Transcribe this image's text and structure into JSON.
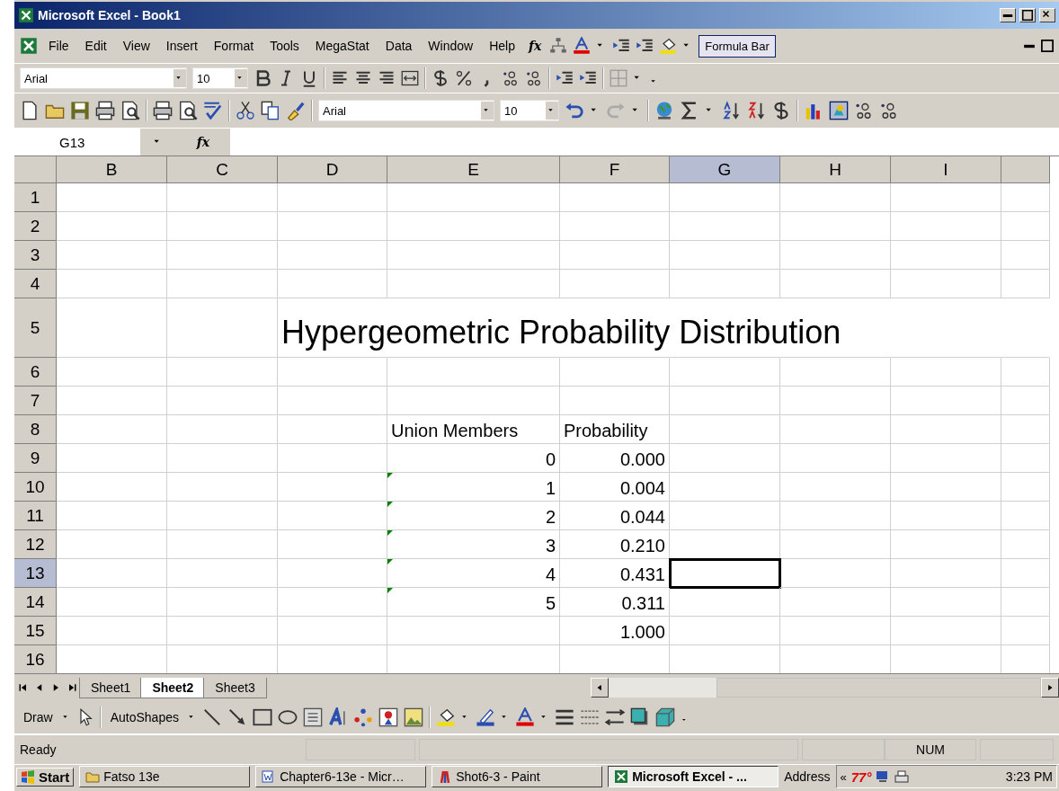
{
  "window": {
    "title": "Microsoft Excel - Book1"
  },
  "insert_function_label": [
    "fx",
    "fx"
  ],
  "menu_bar": {
    "items": [
      "File",
      "Edit",
      "View",
      "Insert",
      "Format",
      "Tools",
      "MegaStat",
      "Data",
      "Window",
      "Help"
    ],
    "formula_bar_button": "Formula Bar"
  },
  "formatting_toolbar": {
    "font": "Arial",
    "size": "10"
  },
  "standard_toolbar": {
    "font": "Arial",
    "size": "10"
  },
  "name_box": "G13",
  "columns": [
    {
      "label": "B",
      "selected": false
    },
    {
      "label": "C",
      "selected": false
    },
    {
      "label": "D",
      "selected": false
    },
    {
      "label": "E",
      "selected": false
    },
    {
      "label": "F",
      "selected": false
    },
    {
      "label": "G",
      "selected": true
    },
    {
      "label": "H",
      "selected": false
    },
    {
      "label": "I",
      "selected": false
    }
  ],
  "rows": [
    {
      "number": "1",
      "selected": false,
      "cells": {}
    },
    {
      "number": "2",
      "selected": false,
      "cells": {}
    },
    {
      "number": "3",
      "selected": false,
      "cells": {}
    },
    {
      "number": "4",
      "selected": false,
      "cells": {}
    },
    {
      "number": "5",
      "selected": false,
      "cells": {
        "D": {
          "kind": "title",
          "text": "Hypergeometric Probability Distribution"
        }
      }
    },
    {
      "number": "6",
      "selected": false,
      "cells": {}
    },
    {
      "number": "7",
      "selected": false,
      "cells": {}
    },
    {
      "number": "8",
      "selected": false,
      "cells": {
        "E": {
          "kind": "text",
          "text": "Union Members"
        },
        "F": {
          "kind": "text",
          "text": "Probability"
        }
      }
    },
    {
      "number": "9",
      "selected": false,
      "cells": {
        "E": {
          "kind": "number",
          "text": "0",
          "flag": false
        },
        "F": {
          "kind": "number",
          "text": "0.000"
        }
      }
    },
    {
      "number": "10",
      "selected": false,
      "cells": {
        "E": {
          "kind": "number",
          "text": "1",
          "flag": true
        },
        "F": {
          "kind": "number",
          "text": "0.004"
        }
      }
    },
    {
      "number": "11",
      "selected": false,
      "cells": {
        "E": {
          "kind": "number",
          "text": "2",
          "flag": true
        },
        "F": {
          "kind": "number",
          "text": "0.044"
        }
      }
    },
    {
      "number": "12",
      "selected": false,
      "cells": {
        "E": {
          "kind": "number",
          "text": "3",
          "flag": true
        },
        "F": {
          "kind": "number",
          "text": "0.210"
        }
      }
    },
    {
      "number": "13",
      "selected": true,
      "cells": {
        "E": {
          "kind": "number",
          "text": "4",
          "flag": true
        },
        "F": {
          "kind": "number",
          "text": "0.431"
        },
        "G": {
          "kind": "active"
        }
      }
    },
    {
      "number": "14",
      "selected": false,
      "cells": {
        "E": {
          "kind": "number",
          "text": "5",
          "flag": true
        },
        "F": {
          "kind": "number",
          "text": "0.311"
        }
      }
    },
    {
      "number": "15",
      "selected": false,
      "cells": {
        "F": {
          "kind": "number",
          "text": "1.000"
        }
      }
    },
    {
      "number": "16",
      "selected": false,
      "cells": {}
    }
  ],
  "sheet_tabs": [
    {
      "label": "Sheet1",
      "selected": false
    },
    {
      "label": "Sheet2",
      "selected": true
    },
    {
      "label": "Sheet3",
      "selected": false
    }
  ],
  "drawing_toolbar": {
    "draw": "Draw",
    "autoshapes": "AutoShapes"
  },
  "status_bar": {
    "status": "Ready",
    "num": "NUM"
  },
  "taskbar": {
    "start": "Start",
    "tasks": [
      {
        "label": "Fatso 13e",
        "selected": false
      },
      {
        "label": "Chapter6-13e - Micr…",
        "selected": false
      },
      {
        "label": "Shot6-3 - Paint",
        "selected": false
      },
      {
        "label": "Microsoft Excel - ...",
        "selected": true
      }
    ],
    "address": "Address",
    "tray_chevron": "«",
    "temperature": "77°",
    "clock": "3:23 PM"
  }
}
